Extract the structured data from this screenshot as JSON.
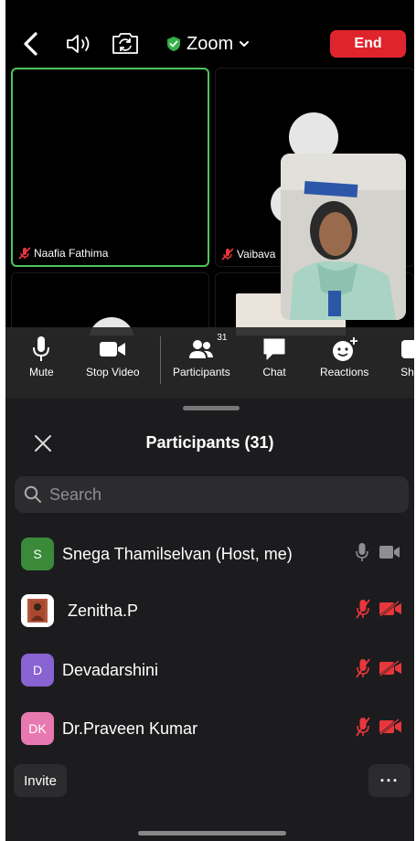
{
  "topbar": {
    "title": "Zoom",
    "end_label": "End",
    "icons": [
      "back-icon",
      "speaker-icon",
      "camera-flip-icon",
      "shield-check-icon",
      "chevron-down-icon"
    ]
  },
  "tiles": [
    {
      "name": "Naafia Fathima",
      "muted": true,
      "active_speaker": true
    },
    {
      "name": "Vaibava",
      "muted": true,
      "active_speaker": false
    }
  ],
  "controls": {
    "mute_label": "Mute",
    "stop_video_label": "Stop Video",
    "participants_label": "Participants",
    "participants_badge": "31",
    "chat_label": "Chat",
    "reactions_label": "Reactions",
    "share_label": "Sh"
  },
  "panel": {
    "title": "Participants (31)",
    "search_placeholder": "Search",
    "participants": [
      {
        "initials": "S",
        "name": "Snega Thamilselvan (Host, me)",
        "avatar_color": "#3a8a3a",
        "muted": false,
        "video_off": false
      },
      {
        "initials": "",
        "name": "Zenitha.P",
        "avatar_color": "#ffffff",
        "muted": true,
        "video_off": true
      },
      {
        "initials": "D",
        "name": "Devadarshini",
        "avatar_color": "#8a63d2",
        "muted": true,
        "video_off": true
      },
      {
        "initials": "DK",
        "name": "Dr.Praveen Kumar",
        "avatar_color": "#e879b0",
        "muted": true,
        "video_off": true
      }
    ],
    "invite_label": "Invite",
    "more_label": "···"
  },
  "colors": {
    "accent_red": "#e0242e",
    "active_border": "#4fc35a",
    "muted_red": "#e8373c"
  }
}
